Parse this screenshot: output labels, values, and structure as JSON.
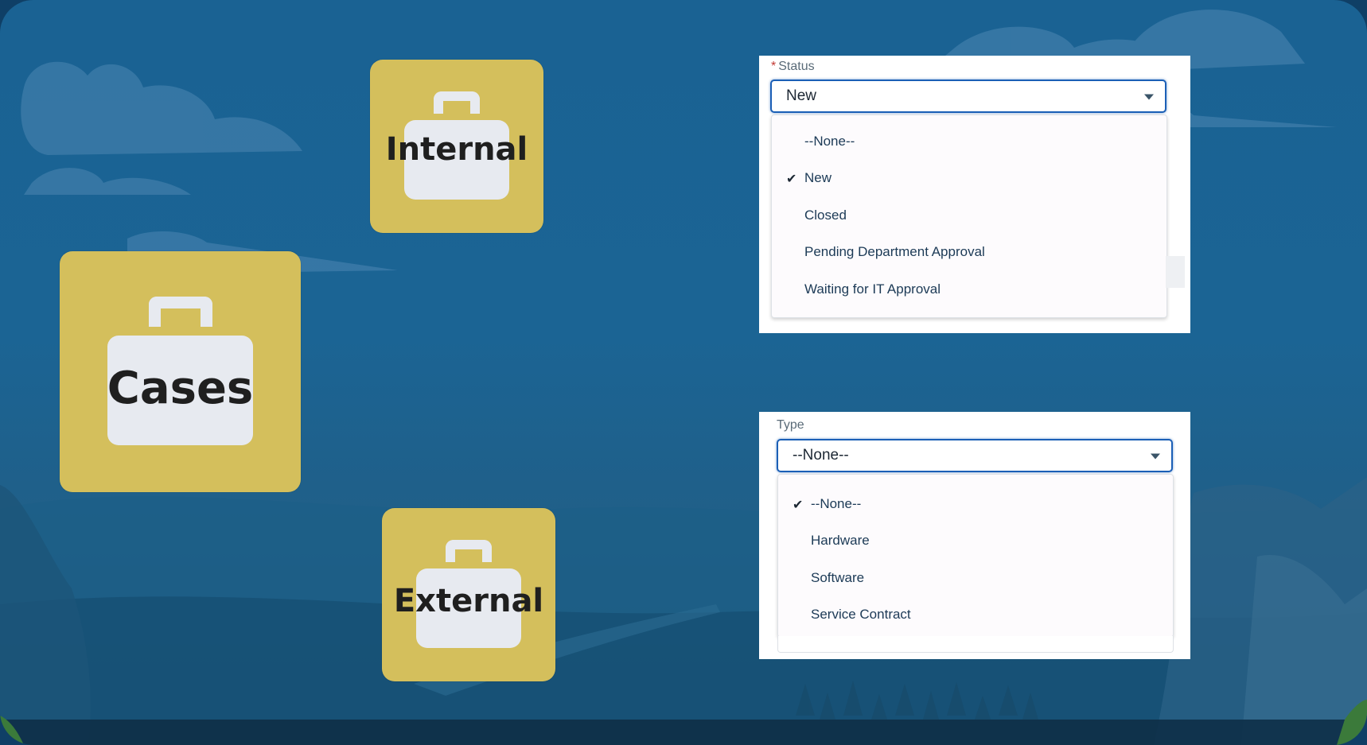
{
  "tiles": {
    "internal": "Internal",
    "cases": "Cases",
    "external": "External"
  },
  "status_field": {
    "required_marker": "*",
    "label": "Status",
    "selected": "New",
    "options": [
      "--None--",
      "New",
      "Closed",
      "Pending Department Approval",
      "Waiting for IT Approval"
    ],
    "checked_option": "New"
  },
  "type_field": {
    "label": "Type",
    "selected": "--None--",
    "options": [
      "--None--",
      "Hardware",
      "Software",
      "Service Contract"
    ],
    "checked_option": "--None--"
  },
  "icons": {
    "briefcase": "briefcase-icon",
    "caret": "chevron-down-icon",
    "check": "check-icon"
  },
  "colors": {
    "tile": "#d4bf5c",
    "focus_border": "#1b5fb6",
    "background": "#1b6494"
  }
}
